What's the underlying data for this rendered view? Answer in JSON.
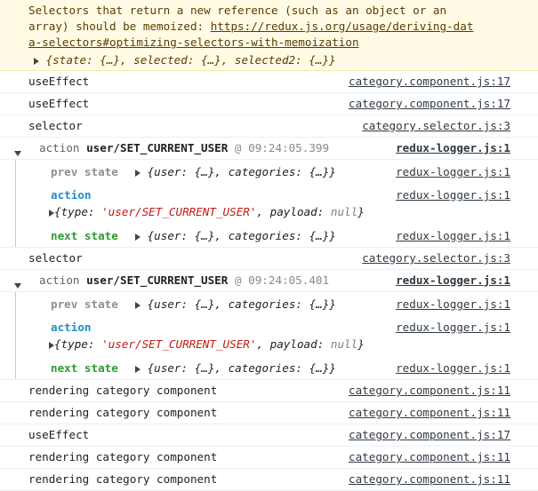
{
  "warning": {
    "line1": "Selectors that return a new reference (such as an object or an",
    "line2_prefix": "array) should be memoized: ",
    "url_part1": "https://redux.js.org/usage/deriving-dat",
    "url_part2": "a-selectors#optimizing-selectors-with-memoization",
    "expand_text": "{state: {…}, selected: {…}, selected2: {…}}"
  },
  "logs": [
    {
      "msg": "useEffect",
      "src": "category.component.js:17"
    },
    {
      "msg": "useEffect",
      "src": "category.component.js:17"
    },
    {
      "msg": "selector",
      "src": "category.selector.js:3"
    }
  ],
  "group1": {
    "action_word": "action",
    "action_type": "user/SET_CURRENT_USER",
    "at": "@",
    "time": "09:24:05.399",
    "src": "redux-logger.js:1",
    "prev_label": "prev state",
    "prev_value": "{user: {…}, categories: {…}}",
    "prev_src": "redux-logger.js:1",
    "action_label": "action",
    "action_src": "redux-logger.js:1",
    "action_obj_open": "{type: ",
    "action_obj_type": "'user/SET_CURRENT_USER'",
    "action_obj_mid": ", payload: ",
    "action_obj_null": "null",
    "action_obj_close": "}",
    "next_label": "next state",
    "next_value": "{user: {…}, categories: {…}}",
    "next_src": "redux-logger.js:1"
  },
  "log_selector": {
    "msg": "selector",
    "src": "category.selector.js:3"
  },
  "group2": {
    "action_word": "action",
    "action_type": "user/SET_CURRENT_USER",
    "at": "@",
    "time": "09:24:05.401",
    "src": "redux-logger.js:1",
    "prev_label": "prev state",
    "prev_value": "{user: {…}, categories: {…}}",
    "prev_src": "redux-logger.js:1",
    "action_label": "action",
    "action_src": "redux-logger.js:1",
    "action_obj_open": "{type: ",
    "action_obj_type": "'user/SET_CURRENT_USER'",
    "action_obj_mid": ", payload: ",
    "action_obj_null": "null",
    "action_obj_close": "}",
    "next_label": "next state",
    "next_value": "{user: {…}, categories: {…}}",
    "next_src": "redux-logger.js:1"
  },
  "logs_after": [
    {
      "msg": "rendering category component",
      "src": "category.component.js:11"
    },
    {
      "msg": "rendering category component",
      "src": "category.component.js:11"
    },
    {
      "msg": "useEffect",
      "src": "category.component.js:17"
    },
    {
      "msg": "rendering category component",
      "src": "category.component.js:11"
    },
    {
      "msg": "rendering category component",
      "src": "category.component.js:11"
    }
  ]
}
